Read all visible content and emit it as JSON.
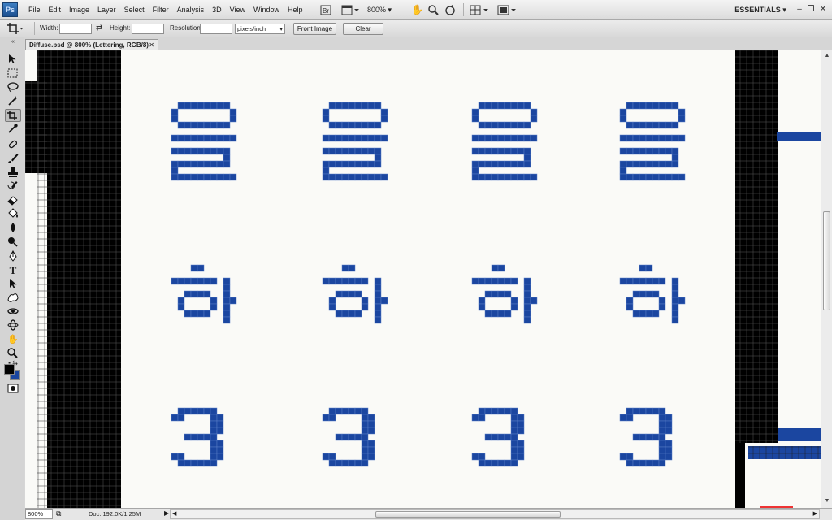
{
  "app": {
    "logo": "Ps",
    "workspace": "ESSENTIALS"
  },
  "menu": [
    "File",
    "Edit",
    "Image",
    "Layer",
    "Select",
    "Filter",
    "Analysis",
    "3D",
    "View",
    "Window",
    "Help"
  ],
  "menubar": {
    "zoom_level": "800%"
  },
  "options_bar": {
    "width_label": "Width:",
    "width_value": "",
    "height_label": "Height:",
    "height_value": "",
    "resolution_label": "Resolution:",
    "resolution_value": "",
    "units_selected": "pixels/inch",
    "front_image_label": "Front Image",
    "clear_label": "Clear"
  },
  "document": {
    "tab_title": "Diffuse.psd @ 800% (Lettering, RGB/8)",
    "glyph_color": "#1b46a0",
    "glyph_rows": [
      "을",
      "하",
      "3"
    ],
    "columns": 4
  },
  "status": {
    "zoom": "800%",
    "doc_info": "Doc: 192.0K/1.25M"
  },
  "colors": {
    "foreground": "#000000",
    "background": "#1b46a0"
  }
}
